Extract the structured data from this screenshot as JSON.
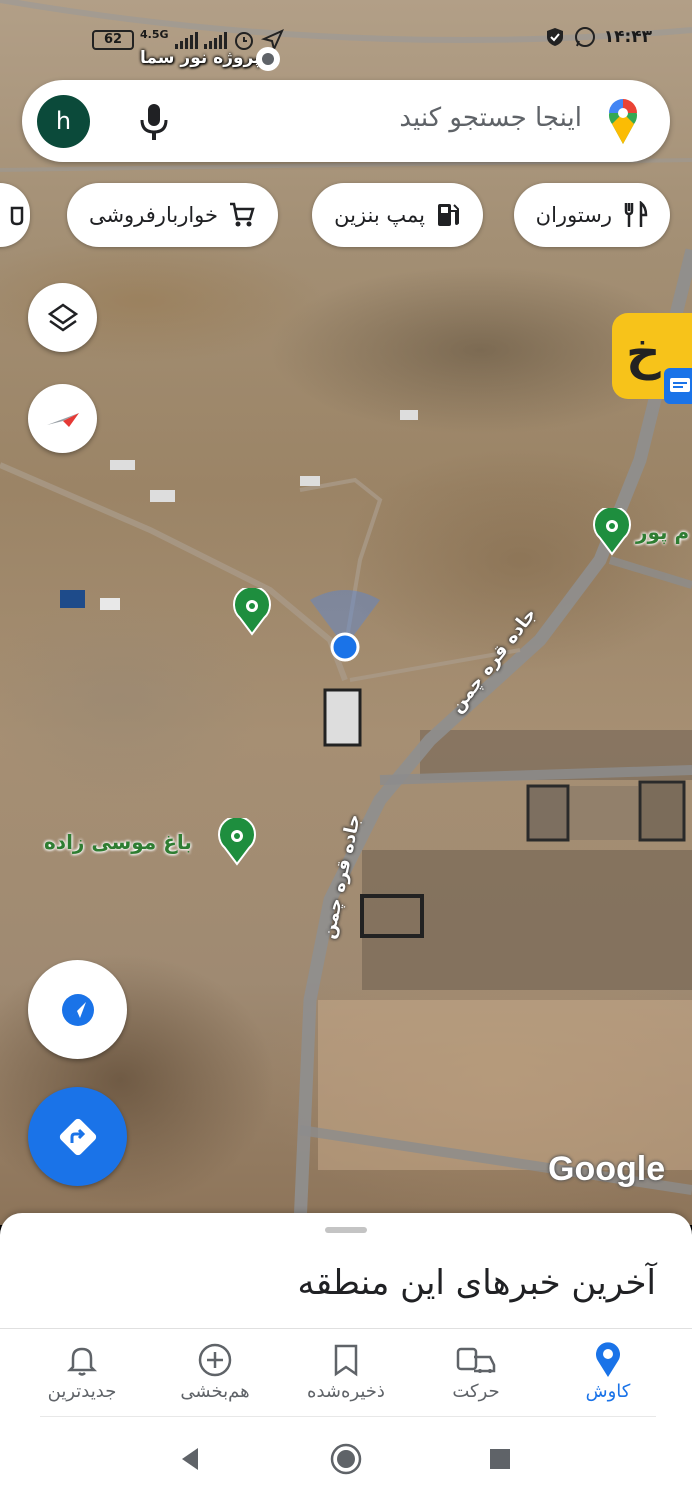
{
  "status_bar": {
    "time": "۱۴:۴۳",
    "battery": "62",
    "network": "4.5G"
  },
  "map": {
    "location_label": "پروژه نور سما",
    "poi_left": "باغ موسی زاده",
    "poi_right": "م پور",
    "road_label_1": "جاده قره چمن",
    "road_label_2": "جاده قره چمن",
    "google_logo": "Google",
    "ad_badge_letter": "خ"
  },
  "search": {
    "placeholder": "اینجا جستجو کنید",
    "avatar_letter": "h"
  },
  "chips": [
    {
      "label": "رستوران",
      "icon": "restaurant-icon"
    },
    {
      "label": "پمپ بنزین",
      "icon": "gas-station-icon"
    },
    {
      "label": "خواربارفروشی",
      "icon": "shopping-cart-icon"
    }
  ],
  "sheet": {
    "title": "آخرین خبرهای این منطقه"
  },
  "nav": {
    "items": [
      {
        "label": "کاوش",
        "icon": "location-pin-icon",
        "active": true
      },
      {
        "label": "حرکت",
        "icon": "commute-icon"
      },
      {
        "label": "ذخیره‌شده",
        "icon": "bookmark-icon"
      },
      {
        "label": "هم‌بخشی",
        "icon": "add-circle-icon"
      },
      {
        "label": "جدیدترین",
        "icon": "bell-icon"
      }
    ]
  },
  "colors": {
    "accent": "#1a73e8",
    "avatar_bg": "#0b4a3a",
    "poi_green": "#2e7d32",
    "ad_yellow": "#f7c31a"
  }
}
